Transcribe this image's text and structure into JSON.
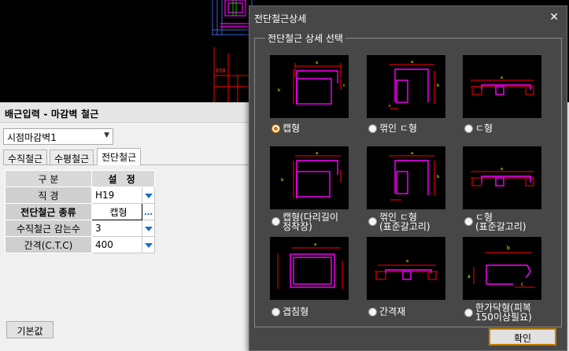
{
  "cad": {
    "dimension_text": "650"
  },
  "left_panel": {
    "title": "배근입력 - 마감벽 철근",
    "wall_select": "시점마감벽1",
    "tabs": [
      "수직철근",
      "수평철근",
      "전단철근"
    ],
    "active_tab_index": 2,
    "table": {
      "header": [
        "구 분",
        "설 정"
      ],
      "rows": [
        {
          "label": "직 경",
          "value": "H19",
          "control": "dropdown"
        },
        {
          "label": "전단철근 종류",
          "value": "캡형",
          "control": "ellipsis"
        },
        {
          "label": "수직철근 감는수",
          "value": "3",
          "control": "dropdown"
        },
        {
          "label": "간격(C.T.C)",
          "value": "400",
          "control": "dropdown"
        }
      ]
    },
    "reset_button": "기본값"
  },
  "dialog": {
    "title": "전단철근상세",
    "group_label": "전단철근 상세 선택",
    "options": [
      {
        "label": "캡형",
        "selected": true,
        "icon": "cap-shape-diagram"
      },
      {
        "label": "꺾인 ㄷ형",
        "selected": false,
        "icon": "bent-c-shape-diagram"
      },
      {
        "label": "ㄷ형",
        "selected": false,
        "icon": "c-shape-diagram"
      },
      {
        "label": "캡형(다리길이\n정착장)",
        "selected": false,
        "icon": "cap-anchorage-diagram"
      },
      {
        "label": "꺾인 ㄷ형\n(표준갈고리)",
        "selected": false,
        "icon": "bent-c-hook-diagram"
      },
      {
        "label": "ㄷ형\n(표준갈고리)",
        "selected": false,
        "icon": "c-hook-diagram"
      },
      {
        "label": "겹침형",
        "selected": false,
        "icon": "overlap-diagram"
      },
      {
        "label": "간격재",
        "selected": false,
        "icon": "spacer-diagram"
      },
      {
        "label": "한가닥형(피복\n150이상필요)",
        "selected": false,
        "icon": "single-strand-diagram"
      }
    ],
    "ok_button": "확인",
    "close_symbol": "✕"
  },
  "colors": {
    "dialog_bg": "#474747",
    "rebar": "#ff00ff",
    "dimension": "#ff0000",
    "label": "#ffff00",
    "accent": "#1a6fc4"
  }
}
